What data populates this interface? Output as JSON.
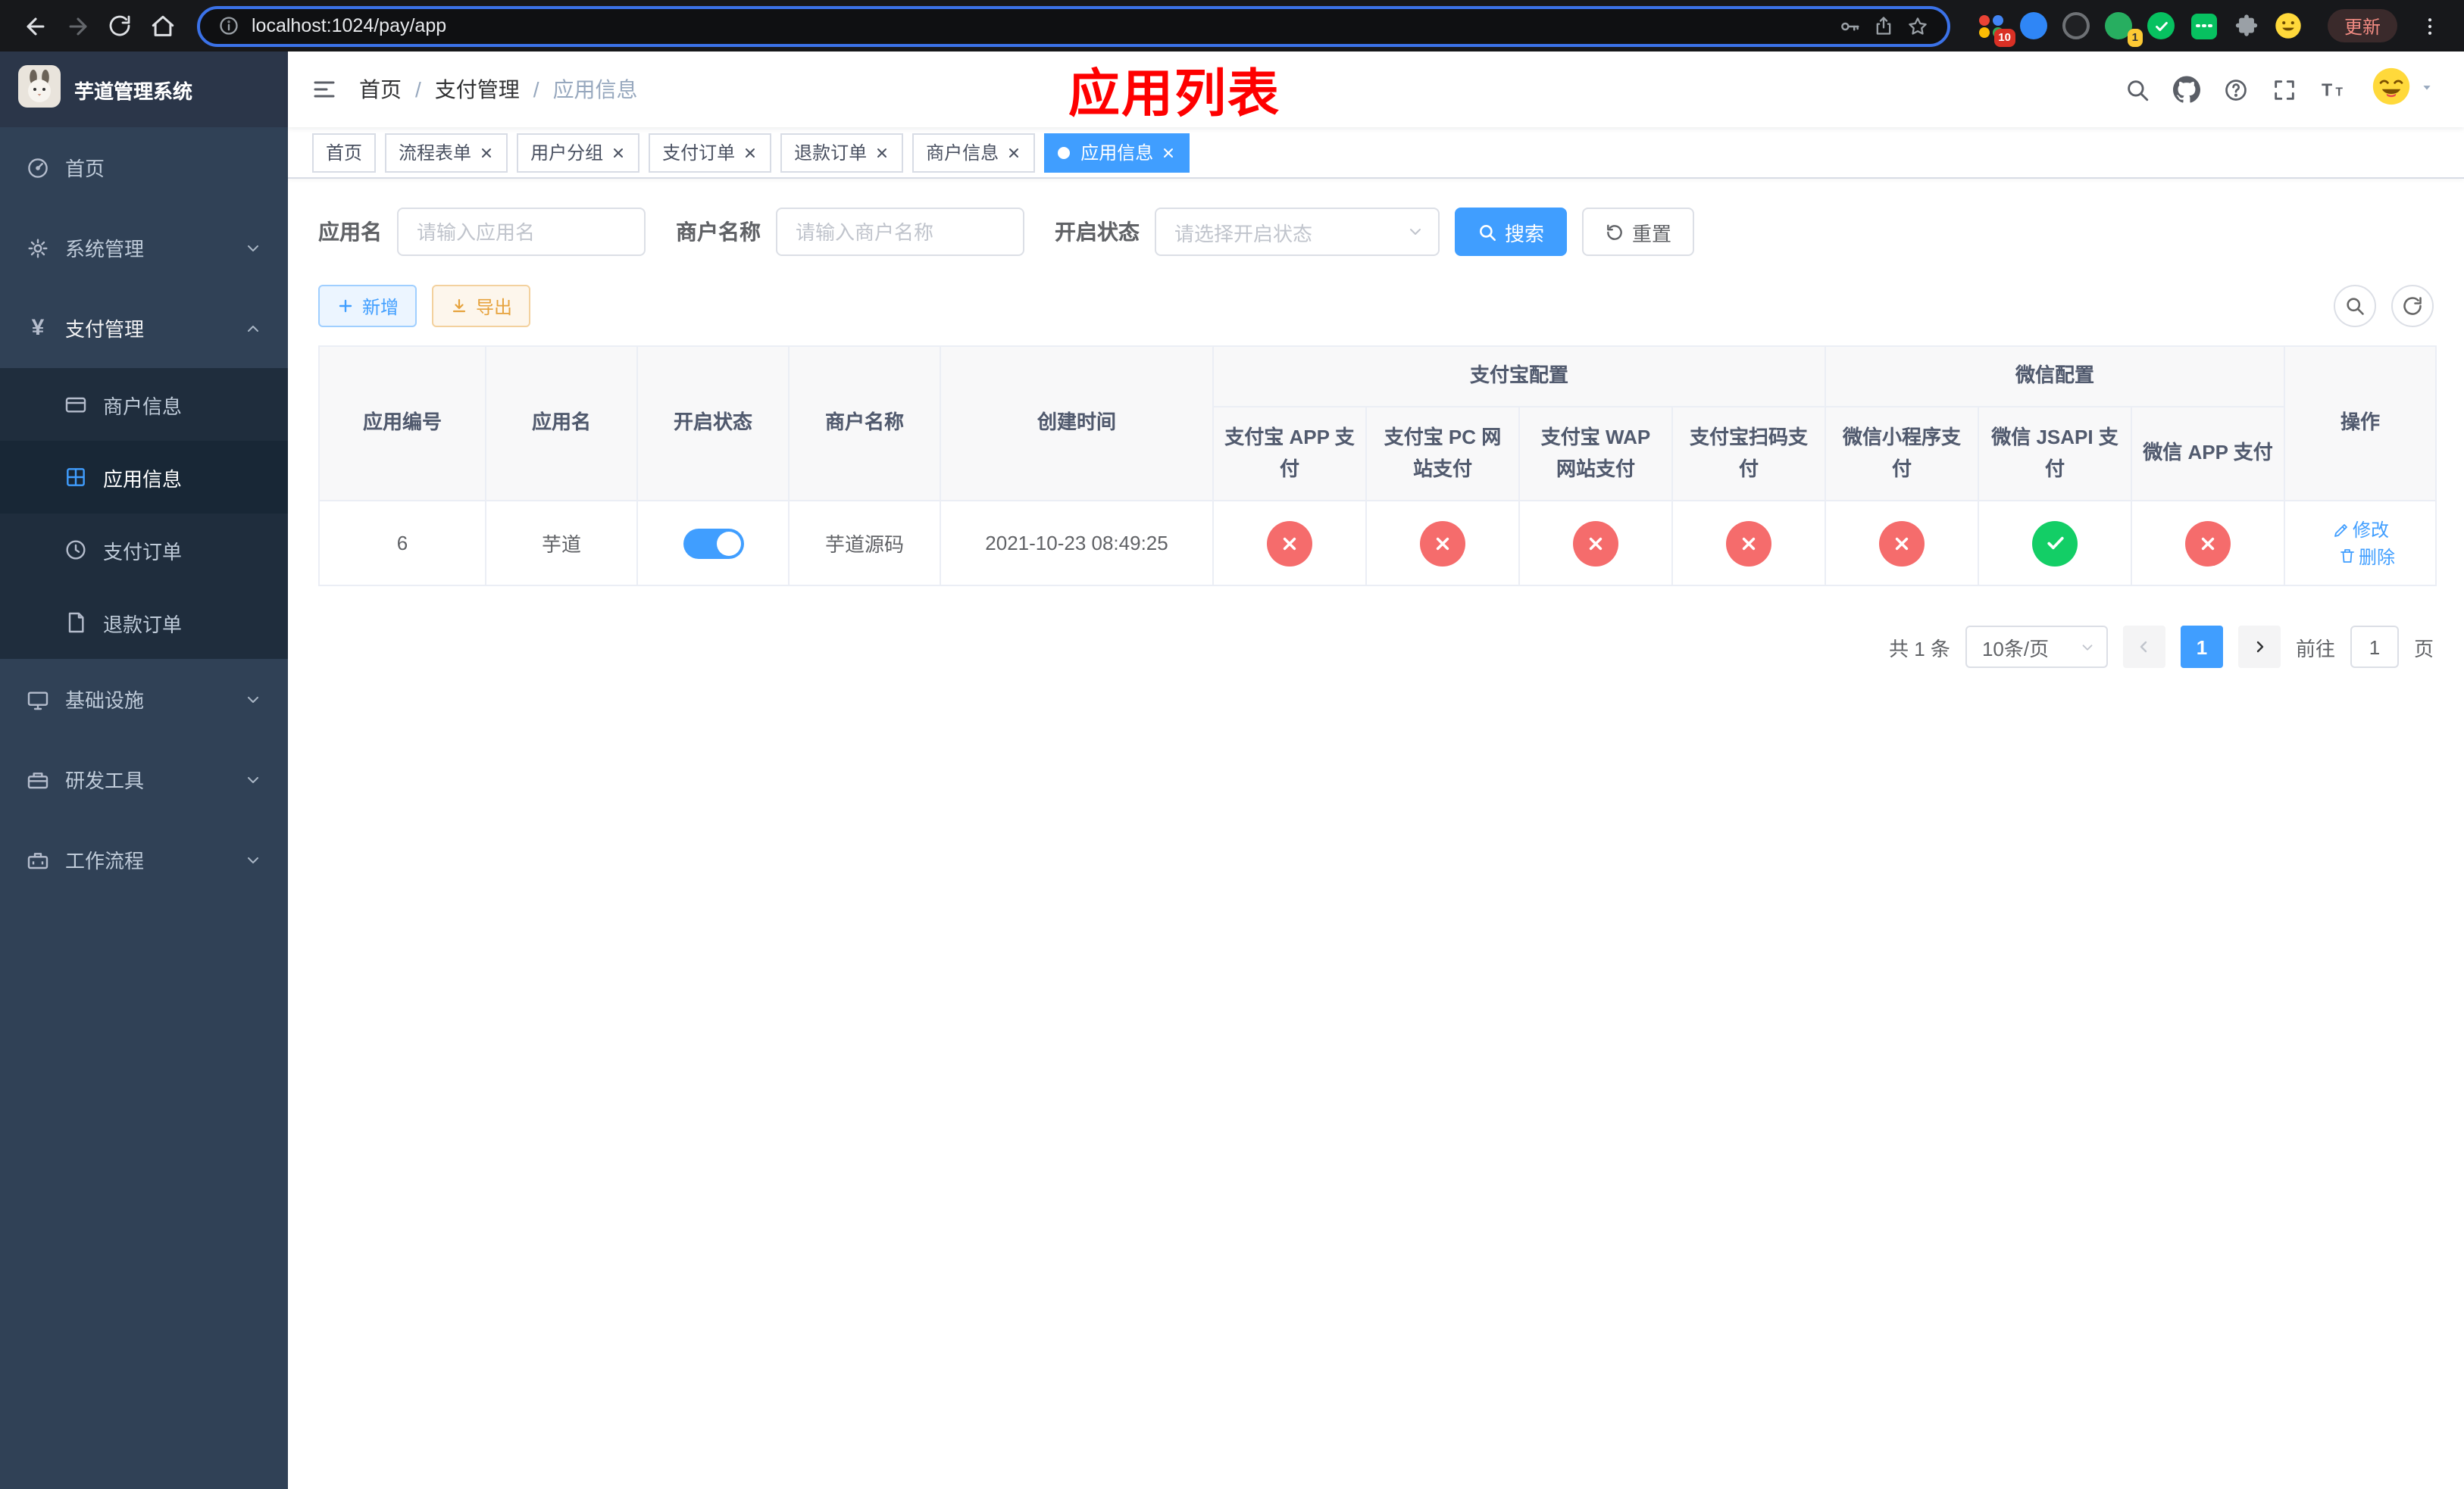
{
  "colors": {
    "accent": "#409eff",
    "danger": "#f56c6c",
    "success": "#13ce66",
    "warning": "#e6a23c",
    "sidebar_bg": "#304156"
  },
  "browser": {
    "url": "localhost:1024/pay/app",
    "update_label": "更新",
    "ext_badge_grid": "10",
    "ext_badge_avatar": "1"
  },
  "sidebar": {
    "title": "芋道管理系统",
    "items": {
      "home": "首页",
      "system": "系统管理",
      "payment": "支付管理",
      "merchant": "商户信息",
      "app": "应用信息",
      "pay_order": "支付订单",
      "refund_order": "退款订单",
      "infra": "基础设施",
      "devtools": "研发工具",
      "workflow": "工作流程"
    }
  },
  "header": {
    "breadcrumb": [
      "首页",
      "支付管理",
      "应用信息"
    ],
    "separator": "/",
    "annotation": "应用列表"
  },
  "tabs": [
    {
      "label": "首页"
    },
    {
      "label": "流程表单"
    },
    {
      "label": "用户分组"
    },
    {
      "label": "支付订单"
    },
    {
      "label": "退款订单"
    },
    {
      "label": "商户信息"
    },
    {
      "label": "应用信息"
    }
  ],
  "filters": {
    "app_name_label": "应用名",
    "app_name_placeholder": "请输入应用名",
    "merchant_label": "商户名称",
    "merchant_placeholder": "请输入商户名称",
    "status_label": "开启状态",
    "status_placeholder": "请选择开启状态",
    "search_button": "搜索",
    "reset_button": "重置"
  },
  "toolbar": {
    "add_button": "新增",
    "export_button": "导出"
  },
  "table": {
    "groups": {
      "alipay": "支付宝配置",
      "wechat": "微信配置"
    },
    "columns": [
      "应用编号",
      "应用名",
      "开启状态",
      "商户名称",
      "创建时间",
      "支付宝 APP 支付",
      "支付宝 PC 网站支付",
      "支付宝 WAP 网站支付",
      "支付宝扫码支付",
      "微信小程序支付",
      "微信 JSAPI 支付",
      "微信 APP 支付",
      "操作"
    ],
    "rows": [
      {
        "id": "6",
        "name": "芋道",
        "enabled": true,
        "merchant": "芋道源码",
        "created": "2021-10-23 08:49:25",
        "alipay_app": false,
        "alipay_pc": false,
        "alipay_wap": false,
        "alipay_qr": false,
        "wechat_mini": false,
        "wechat_jsapi": true,
        "wechat_app": false,
        "actions": {
          "edit": "修改",
          "delete": "删除"
        }
      }
    ]
  },
  "pagination": {
    "total": "共 1 条",
    "page_size": "10条/页",
    "current_page": "1",
    "goto_label": "前往",
    "goto_value": "1",
    "page_label": "页"
  }
}
